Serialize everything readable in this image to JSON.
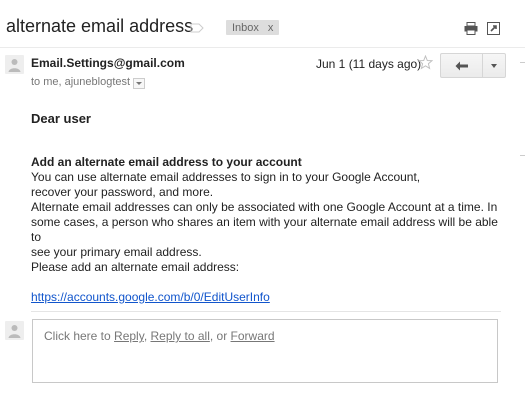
{
  "header": {
    "subject": "alternate email address",
    "label": "Inbox",
    "label_close": "x"
  },
  "message": {
    "sender": "Email.Settings@gmail.com",
    "recipients": "to me, ajuneblogtest",
    "date": "Jun 1 (11 days ago)",
    "greeting": "Dear user",
    "section_title": "Add an alternate email address to your account",
    "lines": [
      "You can use alternate email addresses to sign in to your Google Account,",
      "recover your password, and more.",
      "Alternate email addresses can only be associated with one Google Account at a time. In",
      "some cases, a person who shares an item with your alternate email address will be able to",
      "see your primary email address.",
      "Please add an alternate email address:"
    ],
    "link": "https://accounts.google.com/b/0/EditUserInfo"
  },
  "reply_box": {
    "prefix": "Click here to ",
    "reply": "Reply",
    "sep1": ", ",
    "reply_all": "Reply to all",
    "sep2": ", or ",
    "forward": "Forward"
  },
  "icons": {
    "label": "label-icon",
    "print": "print-icon",
    "new_window": "new-window-icon",
    "star": "star-icon",
    "reply": "reply-arrow-icon",
    "more": "chevron-down-icon",
    "avatar": "person-icon"
  }
}
